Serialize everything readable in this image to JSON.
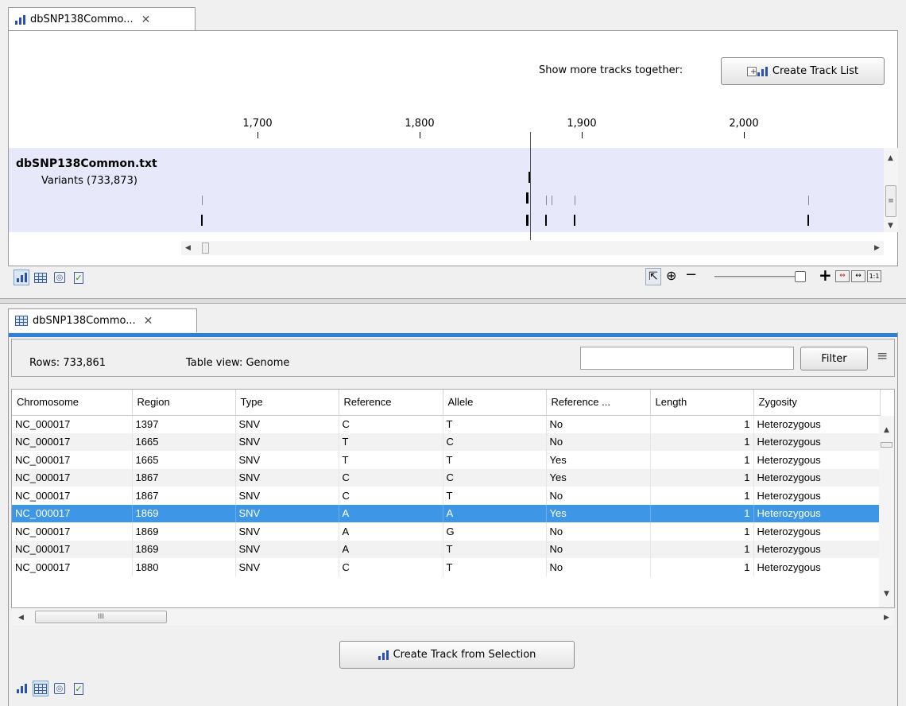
{
  "track_view": {
    "tab_label": "dbSNP138Commo...",
    "show_more_label": "Show more tracks together:",
    "create_track_list_label": "Create Track List",
    "ruler_labels": [
      "1,700",
      "1,800",
      "1,900",
      "2,000"
    ],
    "track_name": "dbSNP138Common.txt",
    "track_subtitle": "Variants (733,873)",
    "bottom_icons": [
      "bar-chart-icon",
      "table-icon",
      "history-icon",
      "validate-icon"
    ],
    "zoom_tools": [
      "select-icon",
      "zoom-in-icon",
      "zoom-out-icon",
      "zoom-slider",
      "zoom-plus-icon",
      "fit-icon",
      "fit-width-icon",
      "actual-size-icon"
    ]
  },
  "table_view": {
    "tab_label": "dbSNP138Commo...",
    "rows_label": "Rows: 733,861",
    "table_view_label": "Table view: Genome",
    "filter_placeholder": "",
    "filter_button": "Filter",
    "columns": [
      "Chromosome",
      "Region",
      "Type",
      "Reference",
      "Allele",
      "Reference ...",
      "Length",
      "Zygosity"
    ],
    "rows": [
      [
        "NC_000017",
        "1397",
        "SNV",
        "C",
        "T",
        "No",
        "1",
        "Heterozygous"
      ],
      [
        "NC_000017",
        "1665",
        "SNV",
        "T",
        "C",
        "No",
        "1",
        "Heterozygous"
      ],
      [
        "NC_000017",
        "1665",
        "SNV",
        "T",
        "T",
        "Yes",
        "1",
        "Heterozygous"
      ],
      [
        "NC_000017",
        "1867",
        "SNV",
        "C",
        "C",
        "Yes",
        "1",
        "Heterozygous"
      ],
      [
        "NC_000017",
        "1867",
        "SNV",
        "C",
        "T",
        "No",
        "1",
        "Heterozygous"
      ],
      [
        "NC_000017",
        "1869",
        "SNV",
        "A",
        "A",
        "Yes",
        "1",
        "Heterozygous"
      ],
      [
        "NC_000017",
        "1869",
        "SNV",
        "A",
        "G",
        "No",
        "1",
        "Heterozygous"
      ],
      [
        "NC_000017",
        "1869",
        "SNV",
        "A",
        "T",
        "No",
        "1",
        "Heterozygous"
      ],
      [
        "NC_000017",
        "1880",
        "SNV",
        "C",
        "T",
        "No",
        "1",
        "Heterozygous"
      ]
    ],
    "selected_row_index": 5,
    "hscroll_grip": "III",
    "create_track_button": "Create Track from Selection"
  },
  "colors": {
    "track_bg": "#e8e8fb",
    "selection": "#3d97e6",
    "accent_bar": "#2e7fd6"
  }
}
